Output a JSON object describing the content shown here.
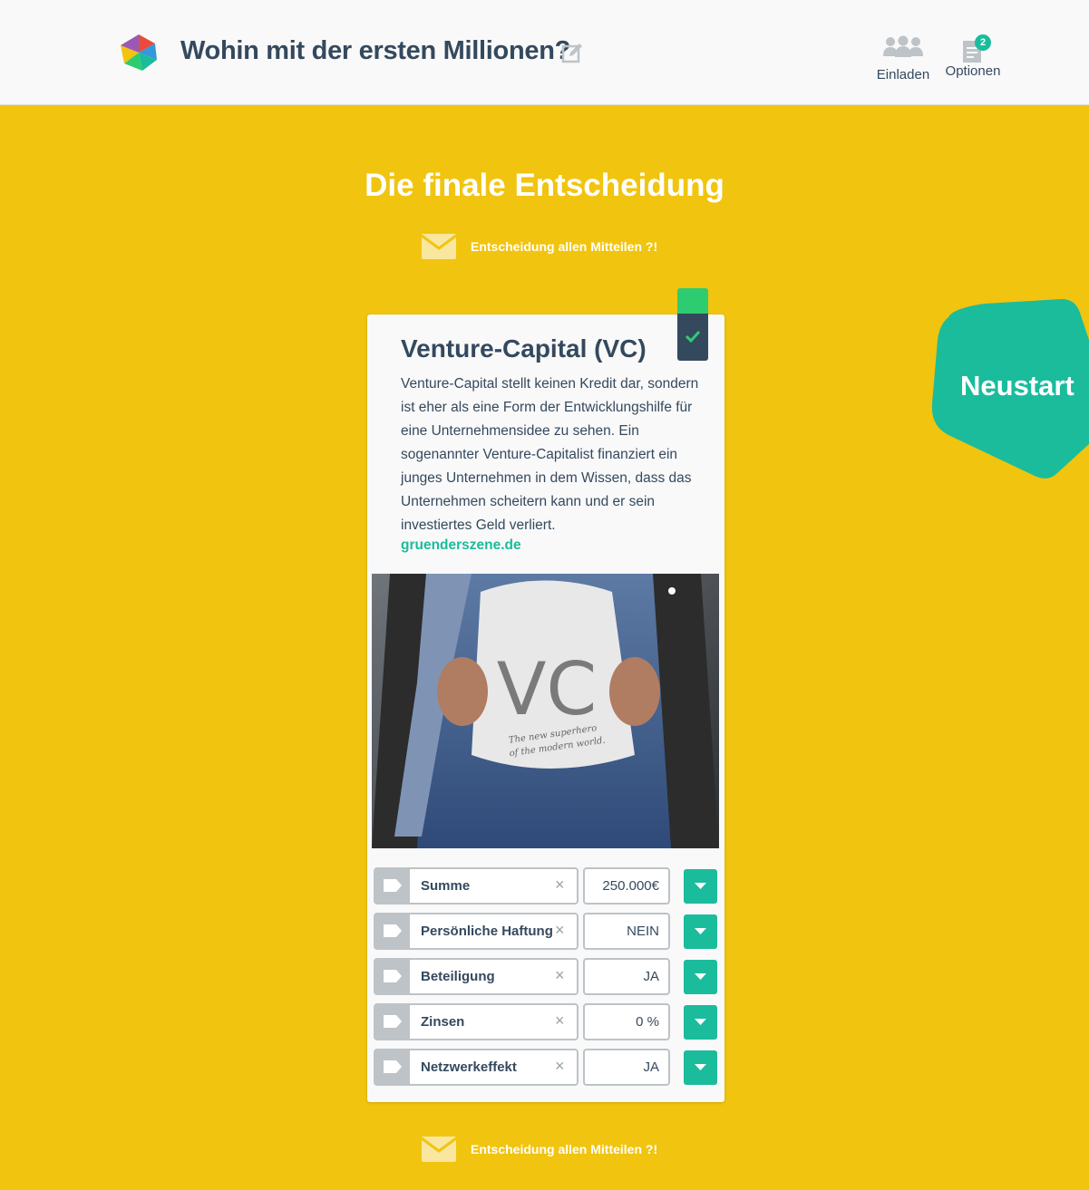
{
  "header": {
    "title": "Wohin mit der ersten Millionen?",
    "actions": [
      {
        "label": "Einladen",
        "icon": "people-icon"
      },
      {
        "label": "Optionen",
        "icon": "document-icon",
        "badge": "2"
      }
    ]
  },
  "main": {
    "title": "Die finale Entscheidung",
    "share_label": "Entscheidung allen Mitteilen ?!",
    "restart_label": "Neustart"
  },
  "card": {
    "title": "Venture-Capital (VC)",
    "description": "Venture-Capital stellt keinen Kredit dar, sondern ist eher als eine Form der Entwicklungshilfe für eine Unternehmensidee zu sehen. Ein sogenannter Venture-Capitalist finanziert ein junges Unternehmen in dem Wissen, dass das Unternehmen scheitern kann und er sein investiertes Geld verliert.",
    "source": "gruenderszene.de",
    "image_text": "VC",
    "image_caption_1": "The new superhero",
    "image_caption_2": "of the modern world.",
    "properties": [
      {
        "name": "Summe",
        "value": "250.000€"
      },
      {
        "name": "Persönliche Haftung",
        "value": "NEIN"
      },
      {
        "name": "Beteiligung",
        "value": "JA"
      },
      {
        "name": "Zinsen",
        "value": "0 %"
      },
      {
        "name": "Netzwerkeffekt",
        "value": "JA"
      }
    ]
  },
  "colors": {
    "background": "#f1c40f",
    "accent": "#1abc9c",
    "dark": "#34495e",
    "selected": "#2ecc71"
  }
}
